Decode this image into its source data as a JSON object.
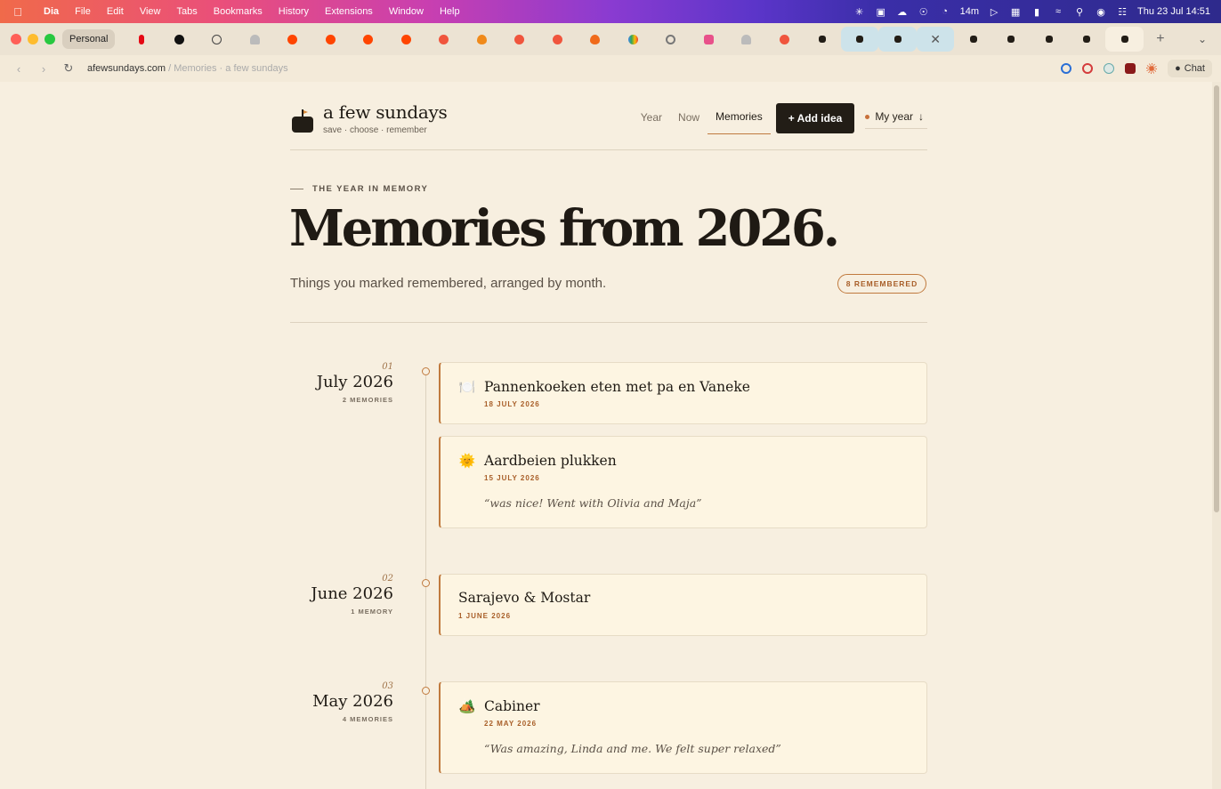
{
  "menubar": {
    "app": "Dia",
    "items": [
      "File",
      "Edit",
      "View",
      "Tabs",
      "Bookmarks",
      "History",
      "Extensions",
      "Window",
      "Help"
    ],
    "status_timer": "14m",
    "clock": "Thu 23 Jul  14:51"
  },
  "tabbar": {
    "profile": "Personal"
  },
  "addressbar": {
    "domain": "afewsundays.com",
    "path": " / Memories · a few sundays",
    "chat_label": "Chat"
  },
  "site": {
    "brand": "a few sundays",
    "tagline": "save · choose · remember",
    "nav": {
      "year": "Year",
      "now": "Now",
      "memories": "Memories",
      "add": "+ Add idea",
      "myyear": "My year",
      "myyear_arrow": "↓"
    }
  },
  "hero": {
    "eyebrow": "THE YEAR IN MEMORY",
    "title": "Memories from 2026.",
    "subtitle": "Things you marked remembered, arranged by month.",
    "badge": "8 REMEMBERED"
  },
  "months": [
    {
      "num": "01",
      "name": "July 2026",
      "count": "2 MEMORIES"
    },
    {
      "num": "02",
      "name": "June 2026",
      "count": "1 MEMORY"
    },
    {
      "num": "03",
      "name": "May 2026",
      "count": "4 MEMORIES"
    }
  ],
  "memories": [
    {
      "emoji": "🍽️",
      "icon": "plate-icon",
      "title": "Pannenkoeken eten met pa en Vaneke",
      "date": "18 JULY 2026",
      "note": ""
    },
    {
      "emoji": "🌞",
      "icon": "sun-icon",
      "title": "Aardbeien plukken",
      "date": "15 JULY 2026",
      "note": "“was nice! Went with Olivia and Maja”"
    },
    {
      "emoji": "",
      "icon": "",
      "title": "Sarajevo & Mostar",
      "date": "1 JUNE 2026",
      "note": ""
    },
    {
      "emoji": "🏕️",
      "icon": "tent-icon",
      "title": "Cabiner",
      "date": "22 MAY 2026",
      "note": "“Was amazing, Linda and me. We felt super relaxed”"
    }
  ],
  "colors": {
    "accent": "#c07a3e",
    "background": "#f7efe0",
    "card": "#fdf5e2",
    "dark_button": "#221d16"
  }
}
